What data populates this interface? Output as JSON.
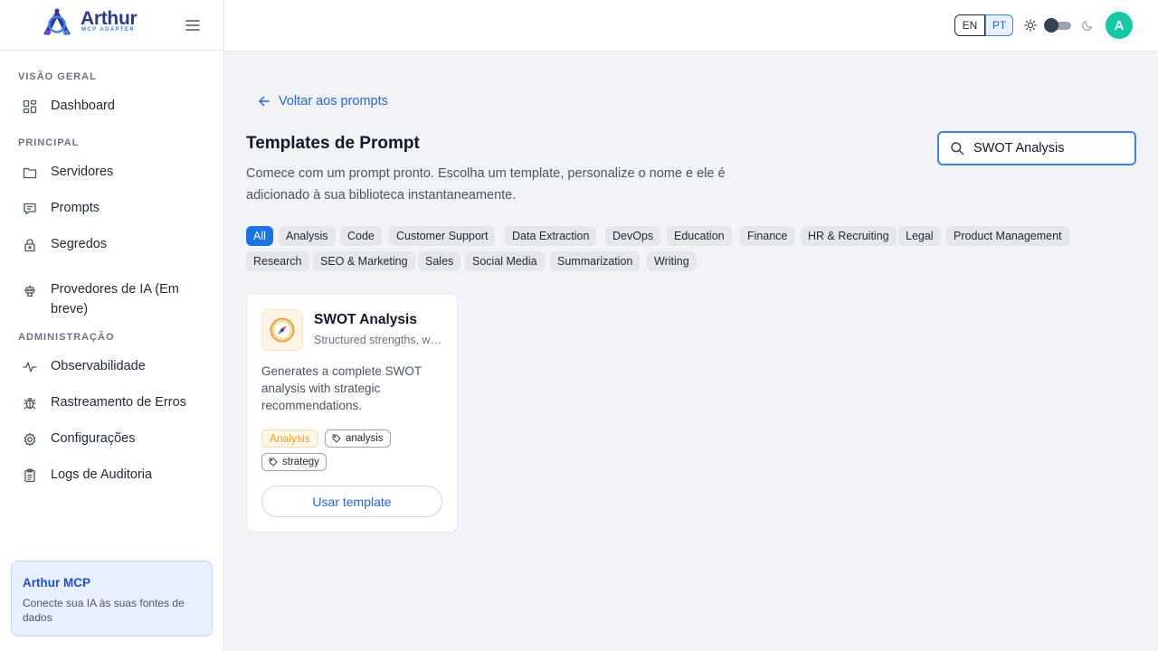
{
  "brand": {
    "name": "Arthur",
    "subtitle": "MCP ADAPTER"
  },
  "sidebar": {
    "sections": [
      {
        "title": "VISÃO GERAL",
        "items": [
          {
            "label": "Dashboard",
            "icon": "dashboard-icon"
          }
        ]
      },
      {
        "title": "PRINCIPAL",
        "items": [
          {
            "label": "Servidores",
            "icon": "folder-icon"
          },
          {
            "label": "Prompts",
            "icon": "message-icon"
          },
          {
            "label": "Segredos",
            "icon": "lock-icon"
          },
          {
            "label": "Provedores de IA (Em breve)",
            "icon": "bot-icon"
          }
        ]
      },
      {
        "title": "ADMINISTRAÇÃO",
        "items": [
          {
            "label": "Observabilidade",
            "icon": "activity-icon"
          },
          {
            "label": "Rastreamento de Erros",
            "icon": "bug-icon"
          },
          {
            "label": "Configurações",
            "icon": "gear-icon"
          },
          {
            "label": "Logs de Auditoria",
            "icon": "clipboard-icon"
          }
        ]
      }
    ],
    "promo": {
      "title": "Arthur MCP",
      "text": "Conecte sua IA às suas fontes de dados"
    }
  },
  "header": {
    "lang_en": "EN",
    "lang_pt": "PT",
    "active_lang": "PT",
    "avatar_initial": "A",
    "avatar_color": "#14c9a6"
  },
  "main": {
    "back_label": "Voltar aos prompts",
    "title": "Templates de Prompt",
    "description": "Comece com um prompt pronto. Escolha um template, personalize o nome e ele é adicionado à sua biblioteca instantaneamente.",
    "search": {
      "value": "SWOT Analysis",
      "placeholder": ""
    },
    "categories": [
      "All",
      "Analysis",
      "Code",
      "Customer Support",
      "Data Extraction",
      "DevOps",
      "Education",
      "Finance",
      "HR & Recruiting",
      "Legal",
      "Product Management",
      "Research",
      "SEO & Marketing",
      "Sales",
      "Social Media",
      "Summarization",
      "Writing"
    ],
    "active_category": "All",
    "templates": [
      {
        "icon": "compass-icon",
        "title": "SWOT Analysis",
        "subtitle": "Structured strengths, weaknesses, opportunities and threats",
        "description": "Generates a complete SWOT analysis with strategic recommendations.",
        "category": "Analysis",
        "tags": [
          "analysis",
          "strategy"
        ],
        "action_label": "Usar template"
      }
    ]
  },
  "colors": {
    "accent": "#1a73e8",
    "brand": "#2a3a8f",
    "category_tag": "#f59e0b"
  }
}
